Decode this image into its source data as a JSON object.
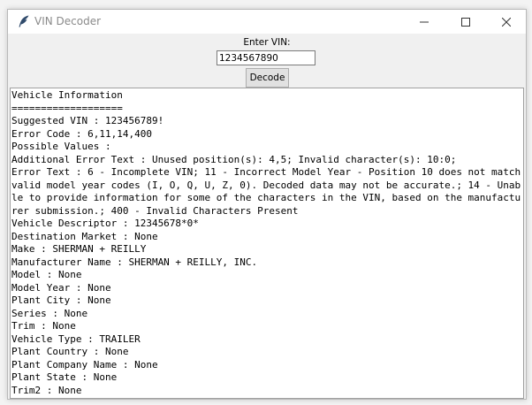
{
  "window": {
    "title": "VIN Decoder"
  },
  "form": {
    "label": "Enter VIN:",
    "vin_value": "1234567890",
    "decode_label": "Decode"
  },
  "output": {
    "lines": [
      "Vehicle Information",
      "===================",
      "Suggested VIN : 123456789!",
      "Error Code : 6,11,14,400",
      "Possible Values :",
      "Additional Error Text : Unused position(s): 4,5; Invalid character(s): 10:0;",
      "Error Text : 6 - Incomplete VIN; 11 - Incorrect Model Year - Position 10 does not match valid model year codes (I, O, Q, U, Z, 0). Decoded data may not be accurate.; 14 - Unable to provide information for some of the characters in the VIN, based on the manufacturer submission.; 400 - Invalid Characters Present",
      "Vehicle Descriptor : 12345678*0*",
      "Destination Market : None",
      "Make : SHERMAN + REILLY",
      "Manufacturer Name : SHERMAN + REILLY, INC.",
      "Model : None",
      "Model Year : None",
      "Plant City : None",
      "Series : None",
      "Trim : None",
      "Vehicle Type : TRAILER",
      "Plant Country : None",
      "Plant Company Name : None",
      "Plant State : None",
      "Trim2 : None"
    ]
  }
}
